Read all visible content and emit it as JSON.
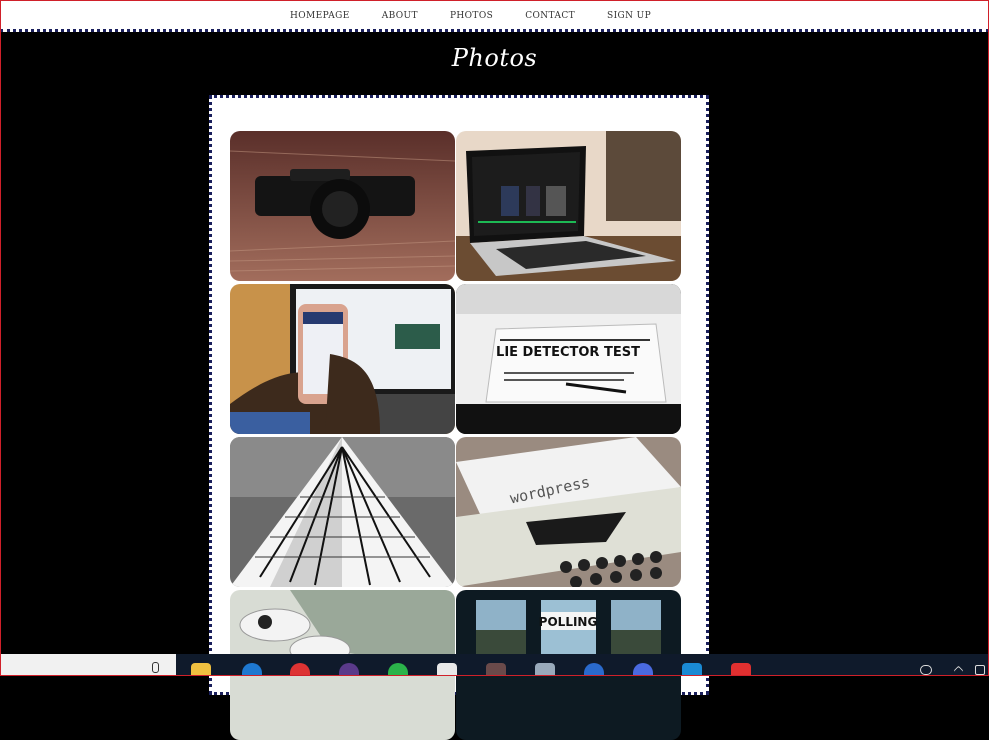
{
  "nav": {
    "links": [
      "HOMEPAGE",
      "ABOUT",
      "PHOTOS",
      "CONTACT",
      "SIGN UP"
    ]
  },
  "page": {
    "title": "Photos"
  },
  "gallery": {
    "photos": [
      {
        "name": "camera-photo"
      },
      {
        "name": "laptop-music-photo"
      },
      {
        "name": "phone-laptop-photo"
      },
      {
        "name": "lie-detector-test-photo",
        "text": "LIE DETECTOR TEST"
      },
      {
        "name": "building-photo"
      },
      {
        "name": "typewriter-wordpress-photo",
        "text": "wordpress"
      },
      {
        "name": "earbuds-tablet-photo"
      },
      {
        "name": "polling-station-photo",
        "text": "POLLING"
      }
    ]
  },
  "taskbar": {
    "icons": [
      "folder-icon",
      "edge-icon",
      "chrome-icon",
      "app-icon",
      "whatsapp-icon",
      "notepad-icon",
      "app-icon-2",
      "app-icon-3",
      "app-icon-4",
      "app-icon-5",
      "vscode-icon",
      "app-icon-6"
    ]
  },
  "colors": {
    "nav_border": "#1a1f5c",
    "page_background": "#000000",
    "panel_background": "#ffffff"
  }
}
